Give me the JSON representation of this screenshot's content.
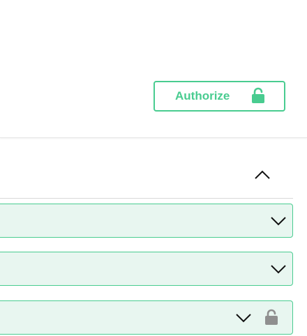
{
  "topbar": {
    "authorize_label": "Authorize",
    "authorize_icon": "unlocked-lock-icon",
    "accent_color": "#49cc90"
  },
  "section": {
    "expanded": true,
    "toggle_icon": "chevron-up-icon",
    "operations": [
      {
        "expanded": false,
        "icon": "chevron-down-icon",
        "locked_icon": null
      },
      {
        "expanded": false,
        "icon": "chevron-down-icon",
        "locked_icon": null
      },
      {
        "expanded": false,
        "icon": "chevron-down-icon",
        "locked_icon": "unlocked-lock-icon"
      }
    ],
    "row_background": "#e8f6f0",
    "row_border": "#49cc90"
  }
}
